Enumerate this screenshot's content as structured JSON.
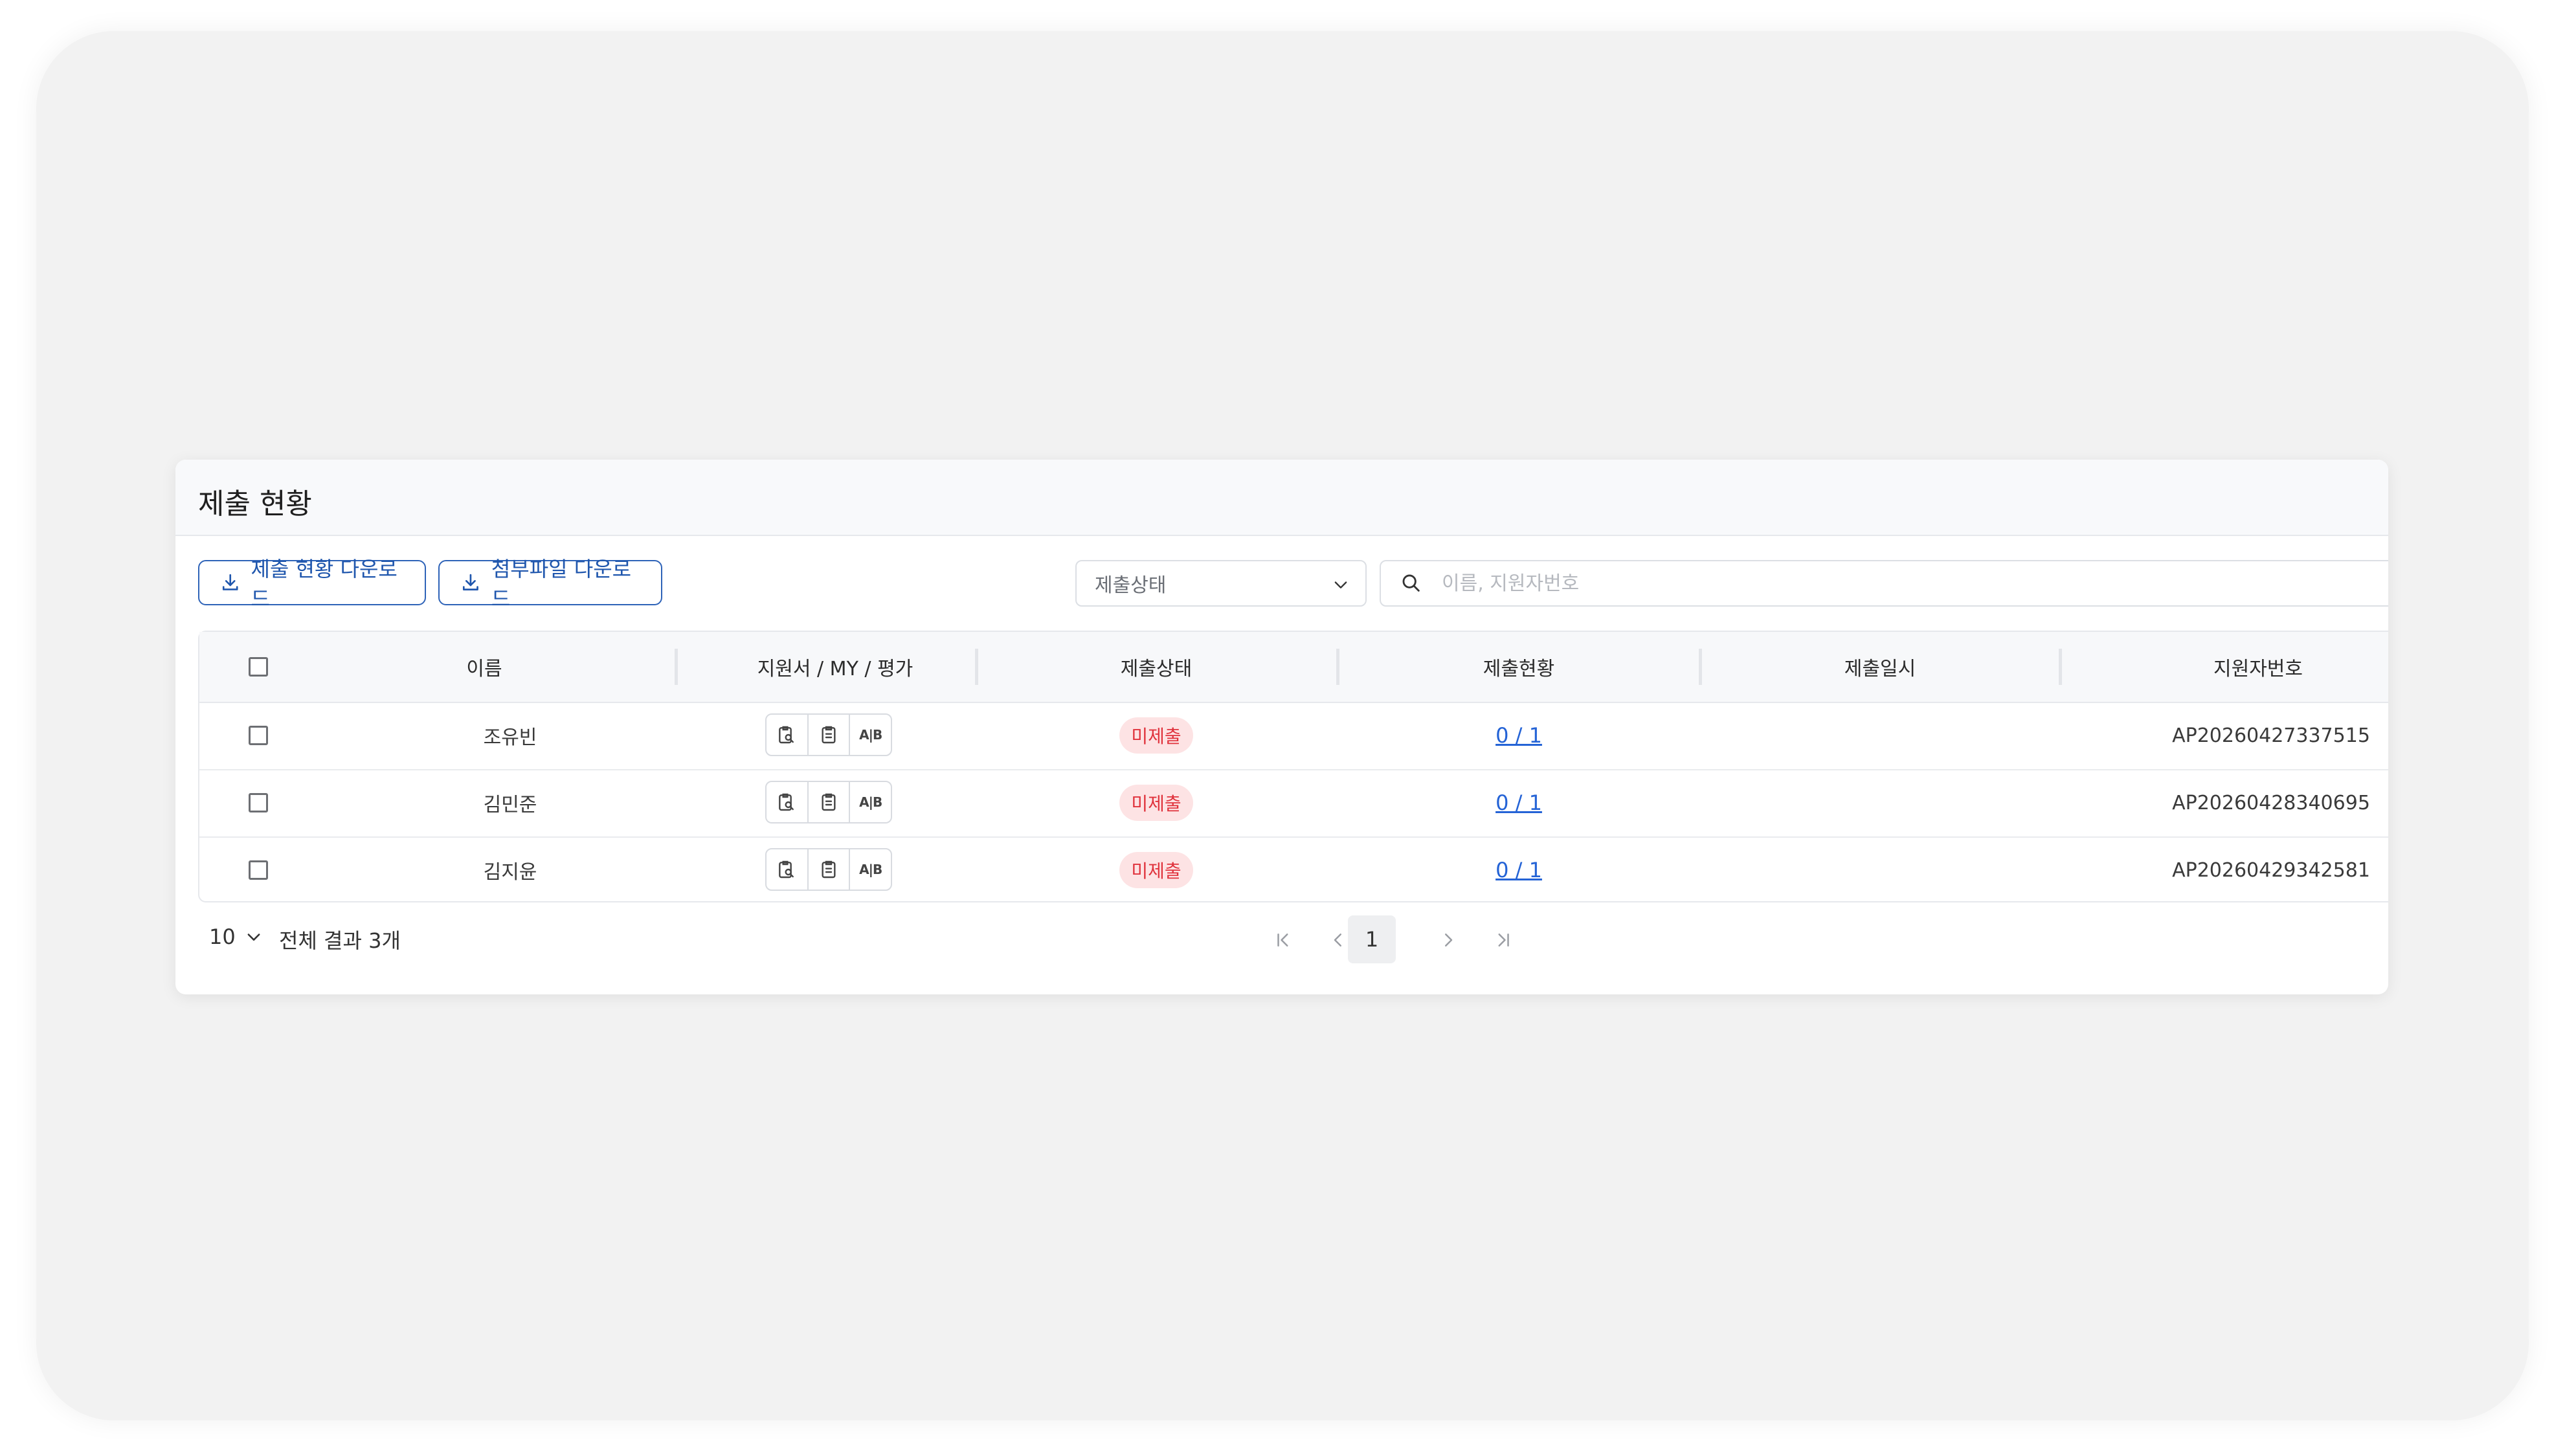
{
  "panel": {
    "title": "제출 현황",
    "download_status_label": "제출 현황 다운로드",
    "download_attachments_label": "첨부파일 다운로드"
  },
  "filters": {
    "status_select_value": "제출상태",
    "search_placeholder": "이름, 지원자번호",
    "search_value": ""
  },
  "table": {
    "columns": [
      "이름",
      "지원서 / MY / 평가",
      "제출상태",
      "제출현황",
      "제출일시",
      "지원자번호"
    ],
    "rows": [
      {
        "name": "조유빈",
        "status": "미제출",
        "progress": "0 / 1",
        "submitted_at": "",
        "applicant_no": "AP20260427337515",
        "ab_label": "A|B"
      },
      {
        "name": "김민준",
        "status": "미제출",
        "progress": "0 / 1",
        "submitted_at": "",
        "applicant_no": "AP20260428340695",
        "ab_label": "A|B"
      },
      {
        "name": "김지윤",
        "status": "미제출",
        "progress": "0 / 1",
        "submitted_at": "",
        "applicant_no": "AP20260429342581",
        "ab_label": "A|B"
      }
    ]
  },
  "footer": {
    "page_size": "10",
    "total_text": "전체 결과 3개",
    "current_page": "1"
  },
  "colors": {
    "accent": "#2e63b8",
    "badge_bg": "#fde3e4",
    "badge_text": "#e0323c",
    "link": "#2463d6"
  },
  "icons": [
    "download-icon",
    "chevron-down-icon",
    "search-icon",
    "document-search-icon",
    "clipboard-icon",
    "ab-test-icon",
    "first-page-icon",
    "prev-page-icon",
    "next-page-icon",
    "last-page-icon"
  ]
}
